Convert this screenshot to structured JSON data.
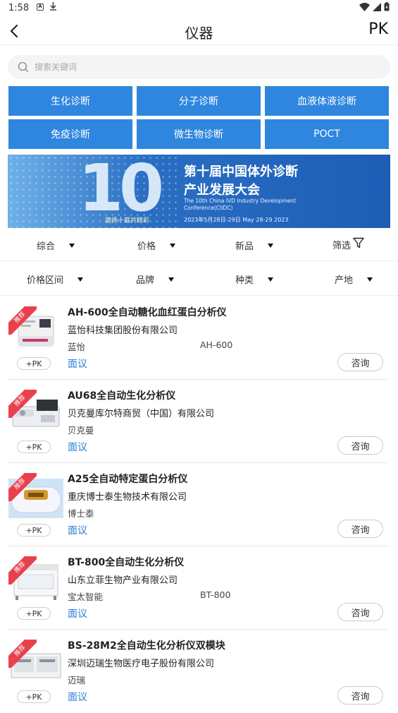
{
  "status_bar": {
    "time": "1:58",
    "a_icon": "A"
  },
  "nav": {
    "title": "仪器",
    "pk_label": "PK"
  },
  "search": {
    "placeholder": "搜索关键词"
  },
  "categories": [
    "生化诊断",
    "分子诊断",
    "血液体液诊断",
    "免疫诊断",
    "微生物诊断",
    "POCT"
  ],
  "banner": {
    "title_line1": "第十届中国体外诊断",
    "title_line2": "产业发展大会",
    "en_text": "The 10th China IVD Industry Development Conference(CIIDC)",
    "date_text": "2023年5月28日-29日  May 28-29 2023",
    "slogan": "激扬十载共精彩",
    "big_number": "10"
  },
  "sort_options": [
    "综合",
    "价格",
    "新品",
    "筛选"
  ],
  "filter_options": [
    "价格区间",
    "品牌",
    "种类",
    "产地"
  ],
  "products": [
    {
      "badge": "推荐",
      "name": "AH-600全自动糖化血红蛋白分析仪",
      "company": "蓝怡科技集团股份有限公司",
      "brand": "蓝怡",
      "model": "AH-600",
      "price": "面议",
      "pk": "+PK",
      "ask": "咨询"
    },
    {
      "badge": "推荐",
      "name": "AU68全自动生化分析仪",
      "company": "贝克曼库尔特商贸（中国）有限公司",
      "brand": "贝克曼",
      "model": "",
      "price": "面议",
      "pk": "+PK",
      "ask": "咨询"
    },
    {
      "badge": "推荐",
      "name": " A25全自动特定蛋白分析仪",
      "company": "重庆博士泰生物技术有限公司",
      "brand": "博士泰",
      "model": "",
      "price": "面议",
      "pk": "+PK",
      "ask": "咨询"
    },
    {
      "badge": "推荐",
      "name": "BT-800全自动生化分析仪",
      "company": "山东立菲生物产业有限公司",
      "brand": "宝太智能",
      "model": "BT-800",
      "price": "面议",
      "pk": "+PK",
      "ask": "咨询"
    },
    {
      "badge": "推荐",
      "name": "BS-28M2全自动生化分析仪双模块",
      "company": "深圳迈瑞生物医疗电子股份有限公司",
      "brand": "迈瑞",
      "model": "",
      "price": "面议",
      "pk": "+PK",
      "ask": "咨询"
    }
  ],
  "colors": {
    "accent": "#2f86de",
    "price": "#2a7fd4",
    "badge": "#e8414b"
  }
}
